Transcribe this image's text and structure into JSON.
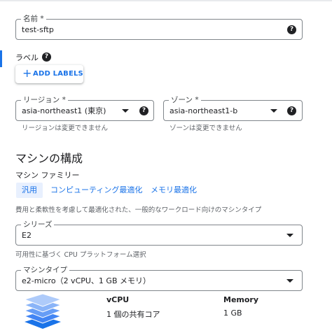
{
  "name_field": {
    "label": "名前 *",
    "value": "test-sftp",
    "help": "?"
  },
  "labels": {
    "title": "ラベル",
    "help": "?",
    "add_button": "ADD LABELS",
    "add_icon": "+"
  },
  "region": {
    "label": "リージョン *",
    "value": "asia-northeast1 (東京)",
    "help": "?",
    "hint": "リージョンは変更できません"
  },
  "zone": {
    "label": "ゾーン *",
    "value": "asia-northeast1-b",
    "help": "?",
    "hint": "ゾーンは変更できません"
  },
  "machine_config": {
    "title": "マシンの構成",
    "family_label": "マシン ファミリー",
    "tabs": [
      {
        "label": "汎用",
        "selected": true
      },
      {
        "label": "コンピューティング最適化",
        "selected": false
      },
      {
        "label": "メモリ最適化",
        "selected": false
      }
    ],
    "family_description": "費用と柔軟性を考慮して最適化された、一般的なワークロード向けのマシンタイプ"
  },
  "series": {
    "label": "シリーズ",
    "value": "E2",
    "hint": "可用性に基づく CPU プラットフォーム選択"
  },
  "machine_type": {
    "label": "マシンタイプ",
    "value": "e2-micro（2 vCPU、1 GB メモリ）"
  },
  "specs": {
    "vcpu_header": "vCPU",
    "vcpu_value": "1 個の共有コア",
    "memory_header": "Memory",
    "memory_value": "1 GB"
  },
  "colors": {
    "accent": "#1a73e8",
    "tab_bg": "#e8f0fe",
    "text": "#202124",
    "hint": "#5f6368"
  }
}
